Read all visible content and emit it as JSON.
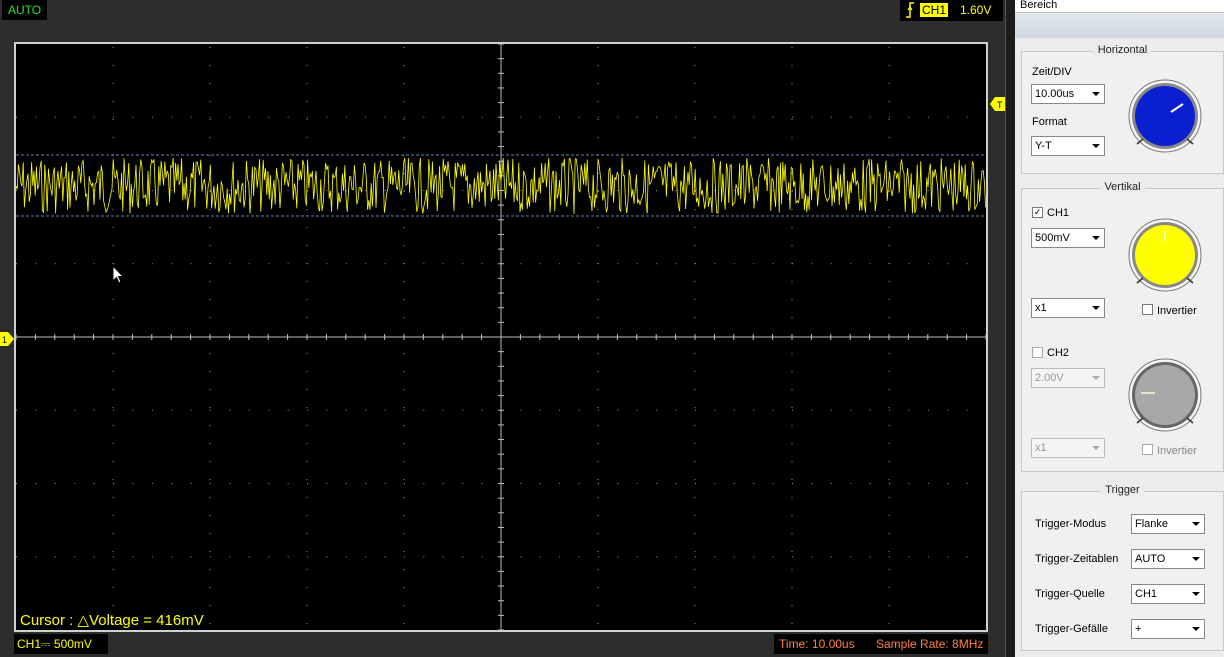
{
  "top": {
    "mode": "AUTO",
    "trigger_channel": "CH1",
    "trigger_level": "1.60V"
  },
  "screen": {
    "cursor_readout": "Cursor : △Voltage = 416mV",
    "ch1_status": "CH1⎓  500mV",
    "time": "Time: 10.00us",
    "sample_rate": "Sample Rate: 8MHz",
    "trigger_marker": "T",
    "channel_marker": "1",
    "trace_color": "#ffff00"
  },
  "panel": {
    "title": "Bereich",
    "horizontal": {
      "title": "Horizontal",
      "timediv_label": "Zeit/DIV",
      "timediv_value": "10.00us",
      "format_label": "Format",
      "format_value": "Y-T",
      "knob_color": "#0a1fcf"
    },
    "vertical": {
      "title": "Vertikal",
      "ch1_label": "CH1",
      "ch1_checked": true,
      "ch1_volts": "500mV",
      "ch1_probe": "x1",
      "ch1_invert_label": "Invertier",
      "ch1_knob_color": "#ffff00",
      "ch2_label": "CH2",
      "ch2_checked": false,
      "ch2_volts": "2.00V",
      "ch2_probe": "x1",
      "ch2_invert_label": "Invertier",
      "ch2_knob_color": "#a8a8a8"
    },
    "trigger": {
      "title": "Trigger",
      "mode_label": "Trigger-Modus",
      "mode_value": "Flanke",
      "sweep_label": "Trigger-Zeitablen",
      "sweep_value": "AUTO",
      "source_label": "Trigger-Quelle",
      "source_value": "CH1",
      "slope_label": "Trigger-Gefälle",
      "slope_value": "+"
    }
  }
}
